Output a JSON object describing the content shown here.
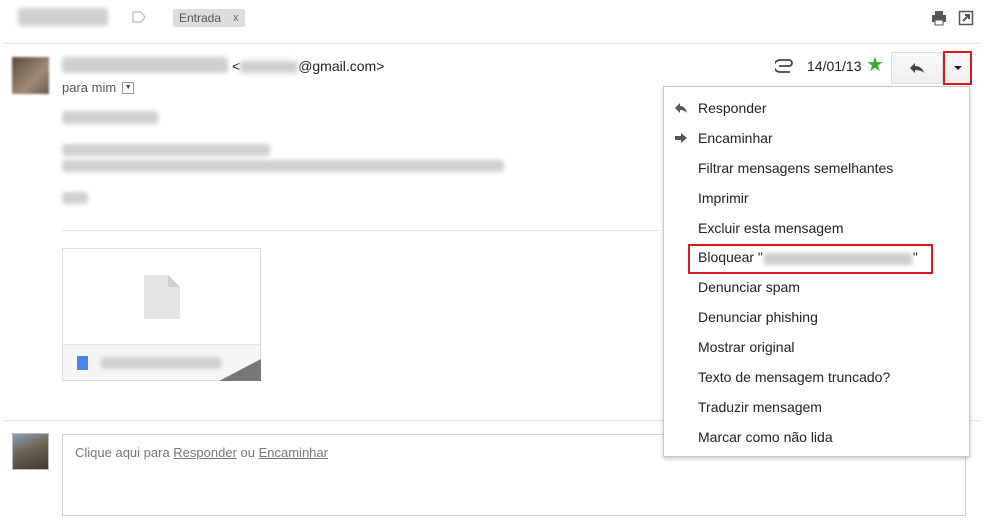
{
  "topbar": {
    "label_chip": "Entrada",
    "label_close": "x"
  },
  "message": {
    "email_open": "<",
    "email_domain": "@gmail.com>",
    "to_label": "para mim",
    "date": "14/01/13"
  },
  "menu": {
    "items": [
      {
        "label": "Responder",
        "icon": "reply-icon"
      },
      {
        "label": "Encaminhar",
        "icon": "forward-icon"
      },
      {
        "label": "Filtrar mensagens semelhantes"
      },
      {
        "label": "Imprimir"
      },
      {
        "label": "Excluir esta mensagem"
      },
      {
        "label_prefix": "Bloquear \"",
        "label_suffix": "\""
      },
      {
        "label": "Denunciar spam"
      },
      {
        "label": "Denunciar phishing"
      },
      {
        "label": "Mostrar original"
      },
      {
        "label": "Texto de mensagem truncado?"
      },
      {
        "label": "Traduzir mensagem"
      },
      {
        "label": "Marcar como não lida"
      }
    ]
  },
  "reply_box": {
    "prefix": "Clique aqui para ",
    "reply_link": "Responder",
    "middle": " ou ",
    "forward_link": "Encaminhar"
  },
  "colors": {
    "highlight": "#d81920",
    "star": "#30b030",
    "file_icon": "#4a86e8"
  }
}
